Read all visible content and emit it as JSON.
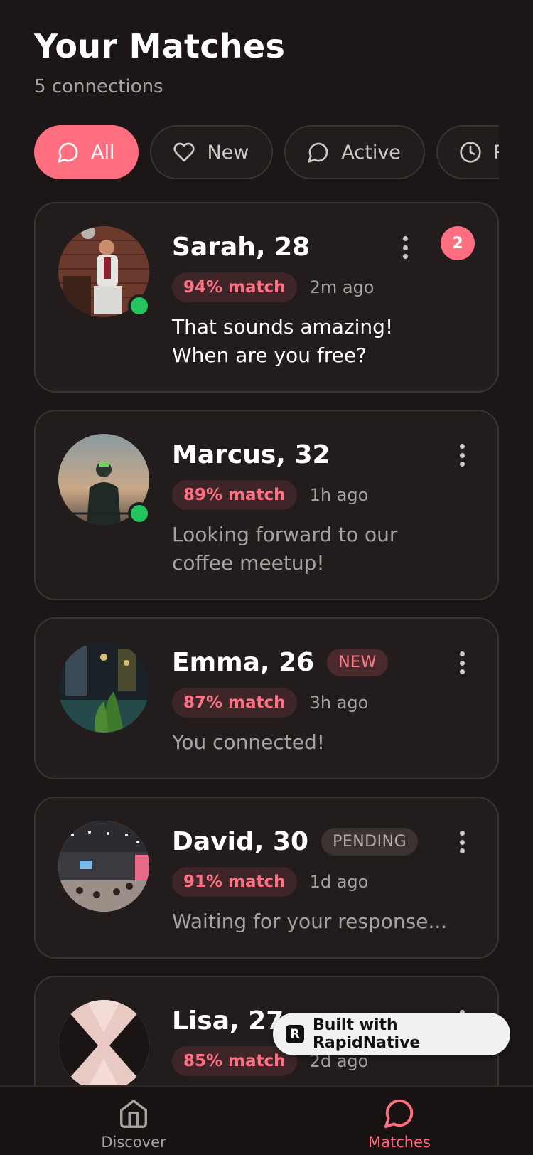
{
  "header": {
    "title": "Your Matches",
    "subtitle": "5 connections"
  },
  "filters": [
    {
      "label": "All",
      "icon": "chat-bubble-icon",
      "active": true
    },
    {
      "label": "New",
      "icon": "heart-icon",
      "active": false
    },
    {
      "label": "Active",
      "icon": "chat-bubble-icon",
      "active": false
    },
    {
      "label": "Pending",
      "icon": "clock-icon",
      "active": false
    }
  ],
  "matches": [
    {
      "name": "Sarah, 28",
      "match": "94% match",
      "time": "2m ago",
      "message": "That sounds amazing! When are you free?",
      "online": true,
      "unread": "2"
    },
    {
      "name": "Marcus, 32",
      "match": "89% match",
      "time": "1h ago",
      "message": "Looking forward to our coffee meetup!",
      "online": true
    },
    {
      "name": "Emma, 26",
      "tag": "NEW",
      "match": "87% match",
      "time": "3h ago",
      "message": "You connected!"
    },
    {
      "name": "David, 30",
      "tag": "PENDING",
      "match": "91% match",
      "time": "1d ago",
      "message": "Waiting for your response..."
    },
    {
      "name": "Lisa, 27",
      "match": "85% match",
      "time": "2d ago"
    }
  ],
  "built_with": "Built with RapidNative",
  "tabbar": {
    "discover": "Discover",
    "matches": "Matches"
  },
  "colors": {
    "accent": "#ff6f7f",
    "background": "#1c1716",
    "card": "#221d1c",
    "online": "#22c55e"
  }
}
